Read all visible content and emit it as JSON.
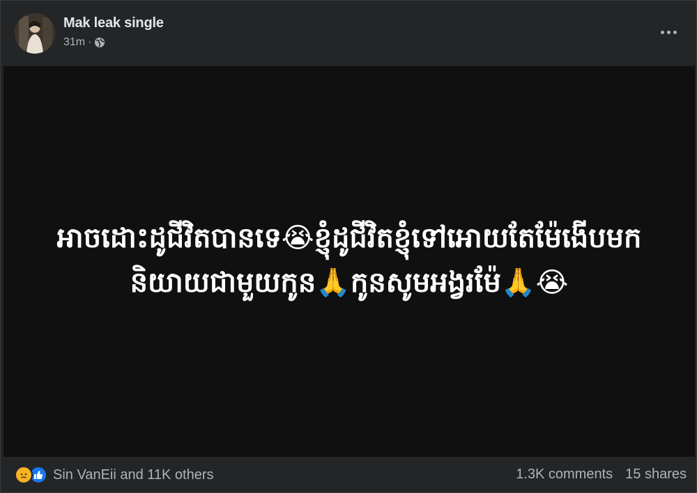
{
  "post": {
    "author": "Mak leak single",
    "time": "31m",
    "separator": "·",
    "privacy_icon": "globe-icon",
    "more_icon": "more-options-icon",
    "text": "អាចដោះដូជីវិតបានទេ😭ខ្ញុំដូជីវិតខ្ញុំទៅអោយតែម៉ែងើបមកនិយាយជាមួយកូន🙏កូនសូមអង្វរម៉ែ🙏😭"
  },
  "footer": {
    "reaction_icons": [
      "sad-icon",
      "like-icon"
    ],
    "reactions_text": "Sin VanEii and 11K others",
    "comments": "1.3K comments",
    "shares": "15 shares"
  },
  "colors": {
    "card_background": "#242526",
    "media_background": "#101010",
    "primary_text": "#e4e6eb",
    "secondary_text": "#b0b3b8",
    "like_blue": "#1877f2",
    "sad_yellow": "#f7b125"
  }
}
